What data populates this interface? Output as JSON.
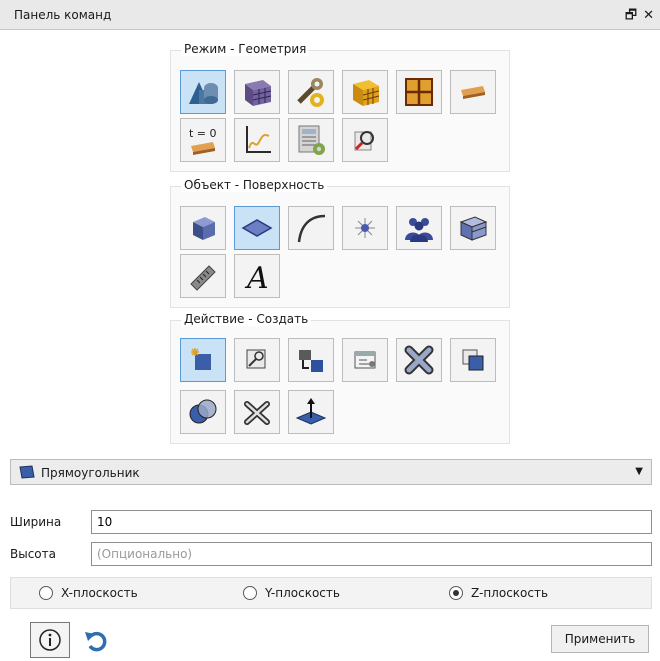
{
  "window": {
    "title": "Панель команд",
    "restore_icon": "restore-icon",
    "close_icon": "close-icon"
  },
  "groups": {
    "mode": {
      "label": "Режим - Геометрия",
      "buttons": [
        "geometry-mode-icon",
        "mesh-mode-icon",
        "tools-mode-icon",
        "block-mode-icon",
        "grid-mode-icon",
        "beam-mode-icon",
        "time-mode-icon",
        "plot-mode-icon",
        "calculator-mode-icon",
        "zoom-mode-icon"
      ]
    },
    "object": {
      "label": "Объект - Поверхность",
      "buttons": [
        "volume-icon",
        "surface-icon",
        "curve-icon",
        "vertex-icon",
        "group-icon",
        "body-icon",
        "measure-icon",
        "text-icon"
      ]
    },
    "action": {
      "label": "Действие - Создать",
      "buttons": [
        "create-icon",
        "modify-icon",
        "transform-icon",
        "properties-icon",
        "delete-icon",
        "copy-icon",
        "boolean-icon",
        "split-icon",
        "normal-icon"
      ]
    }
  },
  "dropdown": {
    "selected": "Прямоугольник",
    "icon": "rectangle-icon"
  },
  "fields": {
    "width_label": "Ширина",
    "width_value": "10",
    "height_label": "Высота",
    "height_placeholder": "(Опционально)"
  },
  "planes": {
    "x_label": "X-плоскость",
    "y_label": "Y-плоскость",
    "z_label": "Z-плоскость",
    "selected": "Z-плоскость"
  },
  "footer": {
    "apply_label": "Применить",
    "info_icon": "info-icon",
    "undo_icon": "undo-icon"
  },
  "colors": {
    "active_button": "#c9e2f6",
    "accent_blue": "#2f6fb0",
    "titlebar": "#e9e9e9"
  }
}
